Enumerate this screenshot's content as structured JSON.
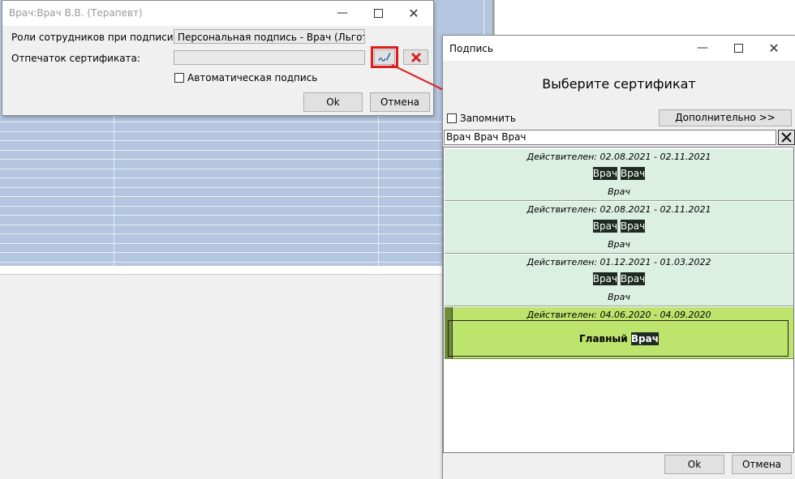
{
  "dialog_main": {
    "title": "Врач:Врач В.В. (Терапевт)",
    "roles_label": "Роли сотрудников при подписи ЭМД:",
    "roles_value": "Персональная подпись - Врач (Льготный рецепт)",
    "cert_label": "Отпечаток сертификата:",
    "cert_value": "",
    "auto_sign_label": "Автоматическая подпись",
    "ok_label": "Ok",
    "cancel_label": "Отмена"
  },
  "dialog_sign": {
    "title": "Подпись",
    "heading": "Выберите сертификат",
    "remember_label": "Запомнить",
    "more_label": "Дополнительно >>",
    "search_value": "Врач Врач Врач",
    "ok_label": "Ok",
    "cancel_label": "Отмена",
    "certificates": [
      {
        "valid": "Действителен: 02.08.2021 - 02.11.2021",
        "name_1": "Врач",
        "name_2": "Врач",
        "org": "Врач"
      },
      {
        "valid": "Действителен: 02.08.2021 - 02.11.2021",
        "name_1": "Врач",
        "name_2": "Врач",
        "org": "Врач"
      },
      {
        "valid": "Действителен: 01.12.2021 - 01.03.2022",
        "name_1": "Врач",
        "name_2": "Врач",
        "org": "Врач"
      },
      {
        "valid": "Действителен: 04.06.2020 - 04.09.2020",
        "name_prefix": "Главный",
        "name_2": "Врач",
        "selected": true
      }
    ]
  },
  "colors": {
    "annotation": "#e01b1b",
    "selected_row": "#bde46d",
    "row": "#dcefe3"
  }
}
